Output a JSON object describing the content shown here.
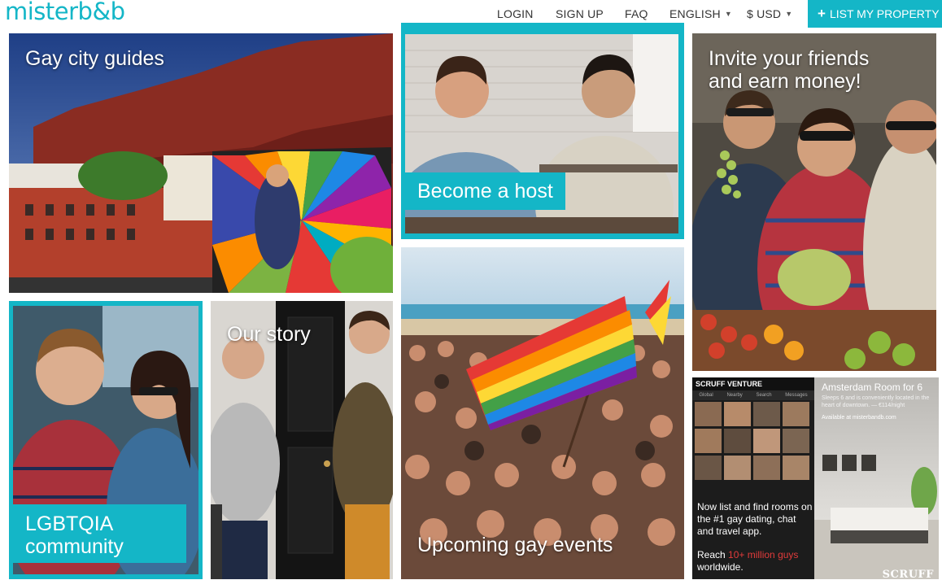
{
  "header": {
    "logo": "misterb&b",
    "login": "LOGIN",
    "signup": "SIGN UP",
    "faq": "FAQ",
    "language": "ENGLISH",
    "currency": "$ USD",
    "list_property": "LIST MY PROPERTY"
  },
  "tiles": {
    "city_guides": "Gay city guides",
    "become_host": "Become a host",
    "invite_line1": "Invite your friends",
    "invite_line2": "and earn money!",
    "community_line1": "LGBTQIA",
    "community_line2": "community",
    "our_story": "Our story",
    "events": "Upcoming gay events"
  },
  "scruff_ad": {
    "app_bar": "SCRUFF VENTURE",
    "tabs": [
      "Global",
      "Nearby",
      "Search",
      "Messages"
    ],
    "room_title": "Amsterdam Room for 6",
    "room_desc": "Sleeps 6 and is conveniently located in the heart of downtown. — €114/night",
    "available": "Available at misterbandb.com",
    "body": "Now list and find rooms on the #1 gay dating, chat and travel app.",
    "reach_prefix": "Reach ",
    "reach_highlight": "10+ million guys",
    "reach_suffix": "worldwide.",
    "brand": "SCRUFF"
  },
  "colors": {
    "brand": "#14b6c7",
    "highlight": "#e23b3b"
  }
}
